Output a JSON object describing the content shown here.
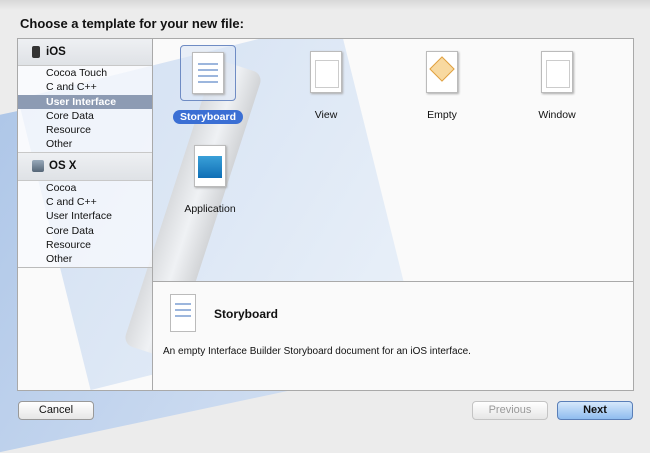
{
  "dialog": {
    "title": "Choose a template for your new file:"
  },
  "sidebar": {
    "sections": [
      {
        "label": "iOS",
        "icon": "iphone-icon",
        "items": [
          "Cocoa Touch",
          "C and C++",
          "User Interface",
          "Core Data",
          "Resource",
          "Other"
        ],
        "selected": 2
      },
      {
        "label": "OS X",
        "icon": "osx-icon",
        "items": [
          "Cocoa",
          "C and C++",
          "User Interface",
          "Core Data",
          "Resource",
          "Other"
        ]
      }
    ]
  },
  "templates": [
    "Storyboard",
    "View",
    "Empty",
    "Window",
    "Application"
  ],
  "selected_template": "Storyboard",
  "detail": {
    "title": "Storyboard",
    "description": "An empty Interface Builder Storyboard document for an iOS interface."
  },
  "buttons": {
    "cancel": "Cancel",
    "previous": "Previous",
    "next": "Next"
  }
}
